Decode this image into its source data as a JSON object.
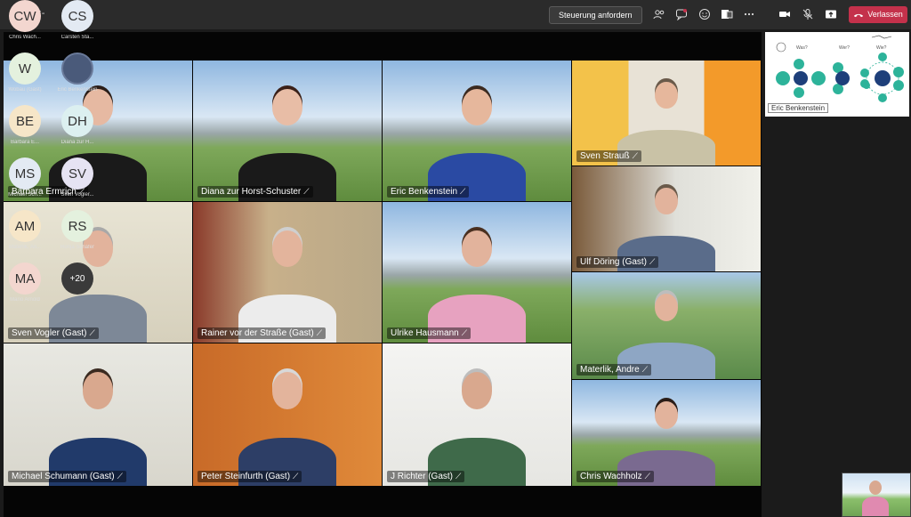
{
  "topbar": {
    "time": "-:-",
    "control_label": "Steuerung anfordern",
    "leave_label": "Verlassen"
  },
  "tiles": [
    {
      "name": "Barbara Ermrich"
    },
    {
      "name": "Diana zur Horst-Schuster"
    },
    {
      "name": "Eric Benkenstein"
    },
    {
      "name": "Sven Strauß"
    },
    {
      "name": "Sven Vogler (Gast)"
    },
    {
      "name": "Rainer vor der Straße (Gast)"
    },
    {
      "name": "Ulrike Hausmann"
    },
    {
      "name": "Ulf Döring (Gast)"
    },
    {
      "name": "Materlik, Andre"
    },
    {
      "name": "Michael Schumann (Gast)"
    },
    {
      "name": "Peter Steinfurth (Gast)"
    },
    {
      "name": "J Richter (Gast)"
    },
    {
      "name": "Chris Wachholz"
    }
  ],
  "share": {
    "presenter": "Eric Benkenstein",
    "headings": [
      "Was?",
      "Wer?",
      "Wie?"
    ]
  },
  "roster": [
    {
      "initials": "CW",
      "name": "Chris Wach...",
      "color": "#f3d6cf"
    },
    {
      "initials": "CS",
      "name": "Carsten Sta...",
      "color": "#e3eaf3"
    },
    {
      "initials": "W",
      "name": "Wobau (Gast)",
      "color": "#e4f1de"
    },
    {
      "initials": "",
      "name": "Eric Benkenstein",
      "color": "#4a5a7a"
    },
    {
      "initials": "BE",
      "name": "Barbara E...",
      "color": "#f6e6c8"
    },
    {
      "initials": "DH",
      "name": "Diana zur H...",
      "color": "#dcf0f0"
    },
    {
      "initials": "MS",
      "name": "Michael Sch...",
      "color": "#e3eaf3"
    },
    {
      "initials": "SV",
      "name": "Sven Vogler...",
      "color": "#e6e3f3"
    },
    {
      "initials": "AM",
      "name": "Materlik, An...",
      "color": "#f6e6c8"
    },
    {
      "initials": "RS",
      "name": "Ronja Schäfer",
      "color": "#e4f1de"
    },
    {
      "initials": "MA",
      "name": "Mario Arnold",
      "color": "#f3d6cf"
    },
    {
      "initials": "+20",
      "name": "",
      "color": "#3a3a3a"
    }
  ]
}
